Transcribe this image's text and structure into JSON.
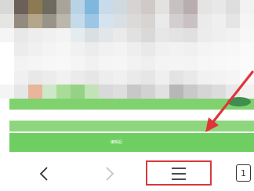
{
  "content": {
    "blurred_caption": "编辑后"
  },
  "nav": {
    "back": "back",
    "forward": "forward",
    "menu": "menu",
    "tabs_count": "1"
  },
  "annotation": {
    "box_color": "#d8393d",
    "arrow_color": "#e0353a"
  }
}
